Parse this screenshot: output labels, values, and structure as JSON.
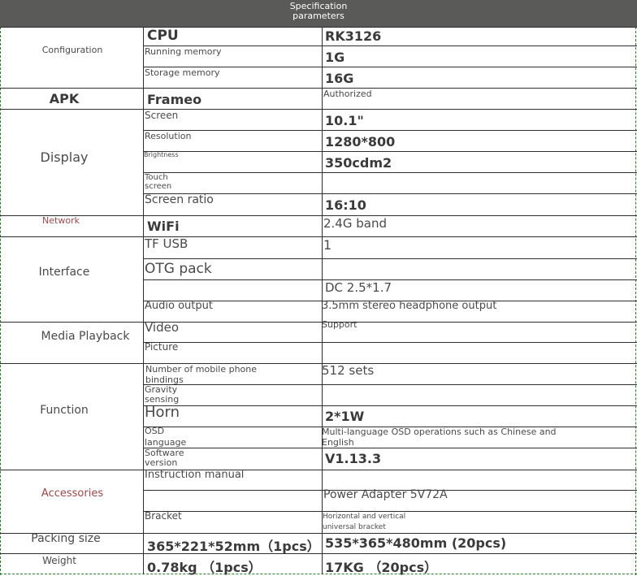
{
  "header": {
    "title": "Specification parameters"
  },
  "categories": {
    "configuration": "Configuration",
    "apk": "APK",
    "display": "Display",
    "network": "Network",
    "interface": "Interface",
    "media": "Media Playback",
    "function": "Function",
    "accessories": "Accessories",
    "packing": "Packing size",
    "weight": "Weight"
  },
  "configuration": {
    "cpu_label": "CPU",
    "cpu_value": "RK3126",
    "ram_label": "Running memory",
    "ram_value": "1G",
    "storage_label": "Storage memory",
    "storage_value": "16G"
  },
  "apk": {
    "label": "Frameo",
    "value": "Authorized"
  },
  "display": {
    "screen_label": "Screen",
    "screen_value": "10.1\"",
    "resolution_label": "Resolution",
    "resolution_value": "1280*800",
    "brightness_label": "Brightness",
    "brightness_value": "350cdm2",
    "touch_label": "Touch screen",
    "ratio_label": "Screen ratio",
    "ratio_value": "16:10"
  },
  "network": {
    "label": "WiFi",
    "value": "2.4G band"
  },
  "interface": {
    "tf_label": "TF USB",
    "tf_value": "1",
    "otg_label": "OTG pack",
    "dc_value": "DC 2.5*1.7",
    "audio_label": "Audio output",
    "audio_value": "3.5mm stereo headphone output"
  },
  "media": {
    "video_label": "Video",
    "video_value": "Support",
    "picture_label": "Picture"
  },
  "function": {
    "binding_label": "Number of mobile phone bindings",
    "binding_value": "512 sets",
    "gravity_label": "Gravity sensing",
    "horn_label": "Horn",
    "horn_value": "2*1W",
    "osd_label": "OSD language",
    "osd_value": "Multi-language OSD operations such as Chinese and English",
    "software_label": "Software version",
    "software_value": "V1.13.3"
  },
  "accessories": {
    "manual_label": "Instruction manual",
    "power_value": "Power Adapter 5V72A",
    "bracket_label": "Bracket",
    "bracket_value": "Horizontal and vertical universal bracket"
  },
  "packing": {
    "single": "365*221*52mm（1pcs）",
    "carton": "535*365*480mm (20pcs)"
  },
  "weight": {
    "single": "0.78kg （1pcs）",
    "carton": "17KG （20pcs）"
  }
}
